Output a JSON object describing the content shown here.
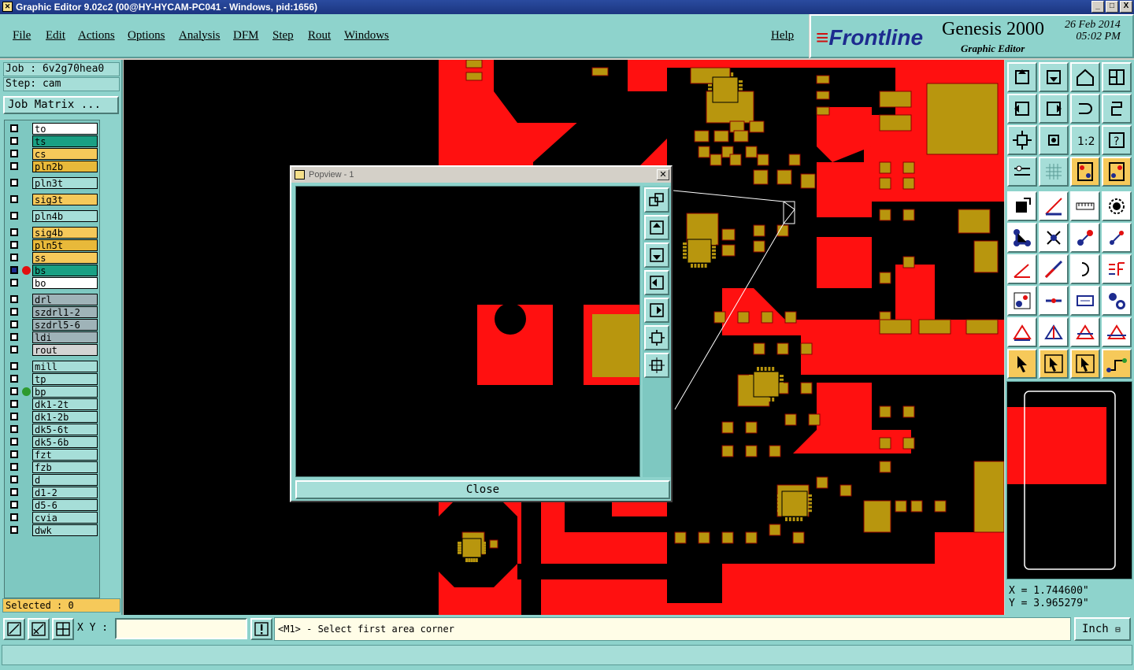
{
  "window": {
    "title": "Graphic Editor 9.02c2 (00@HY-HYCAM-PC041 - Windows, pid:1656)",
    "buttons": [
      "_",
      "□",
      "X"
    ]
  },
  "menu": [
    "File",
    "Edit",
    "Actions",
    "Options",
    "Analysis",
    "DFM",
    "Step",
    "Rout",
    "Windows",
    "Help"
  ],
  "logo": {
    "brand": "Frontline",
    "product": "Genesis 2000",
    "subtitle": "Graphic Editor",
    "date": "26 Feb 2014",
    "time": "05:02 PM"
  },
  "job": {
    "job_label": "Job : 6v2g70hea0",
    "step_label": "Step: cam",
    "matrix_button": "Job Matrix ..."
  },
  "layers": [
    {
      "name": "to",
      "color": "#ffffff",
      "group": 0
    },
    {
      "name": "ts",
      "color": "#1aa084",
      "group": 0
    },
    {
      "name": "cs",
      "color": "#f6c95a",
      "group": 0
    },
    {
      "name": "pln2b",
      "color": "#e8b93a",
      "group": 0
    },
    {
      "name": "pln3t",
      "color": "#a6ded8",
      "group": 1
    },
    {
      "name": "sig3t",
      "color": "#f6c95a",
      "group": 2
    },
    {
      "name": "pln4b",
      "color": "#a6ded8",
      "group": 3
    },
    {
      "name": "sig4b",
      "color": "#f6c95a",
      "group": 4
    },
    {
      "name": "pln5t",
      "color": "#e8b93a",
      "group": 4
    },
    {
      "name": "ss",
      "color": "#f6c95a",
      "group": 4
    },
    {
      "name": "bs",
      "color": "#1aa084",
      "group": 4,
      "dot": "#e21010",
      "active": true
    },
    {
      "name": "bo",
      "color": "#ffffff",
      "group": 4
    },
    {
      "name": "drl",
      "color": "#9fb3b8",
      "group": 5
    },
    {
      "name": "szdrl1-2",
      "color": "#9fb3b8",
      "group": 5
    },
    {
      "name": "szdrl5-6",
      "color": "#9fb3b8",
      "group": 5
    },
    {
      "name": "ldi",
      "color": "#9fb3b8",
      "group": 5
    },
    {
      "name": "rout",
      "color": "#d4d4d4",
      "group": 5
    },
    {
      "name": "mill",
      "color": "#a6ded8",
      "group": 6
    },
    {
      "name": "tp",
      "color": "#a6ded8",
      "group": 6
    },
    {
      "name": "bp",
      "color": "#a6ded8",
      "group": 6,
      "dot": "#2e9a2e"
    },
    {
      "name": "dk1-2t",
      "color": "#a6ded8",
      "group": 6
    },
    {
      "name": "dk1-2b",
      "color": "#a6ded8",
      "group": 6
    },
    {
      "name": "dk5-6t",
      "color": "#a6ded8",
      "group": 6
    },
    {
      "name": "dk5-6b",
      "color": "#a6ded8",
      "group": 6
    },
    {
      "name": "fzt",
      "color": "#a6ded8",
      "group": 6
    },
    {
      "name": "fzb",
      "color": "#a6ded8",
      "group": 6
    },
    {
      "name": "d",
      "color": "#a6ded8",
      "group": 6
    },
    {
      "name": "d1-2",
      "color": "#a6ded8",
      "group": 6
    },
    {
      "name": "d5-6",
      "color": "#a6ded8",
      "group": 6
    },
    {
      "name": "cvia",
      "color": "#a6ded8",
      "group": 6
    },
    {
      "name": "dwk",
      "color": "#a6ded8",
      "group": 6
    }
  ],
  "selected": "Selected : 0",
  "popview": {
    "title": "Popview - 1",
    "close_label": "Close"
  },
  "coords": {
    "x": "X = 1.744600\"",
    "y": "Y = 3.965279\""
  },
  "bottom": {
    "xy_label": "X Y :",
    "xy_value": "",
    "prompt": "<M1> - Select first area corner",
    "units": "Inch"
  },
  "colors": {
    "copper": "#ff1010",
    "pad": "#b8960e",
    "background": "#000000",
    "panel": "#8ed3cc"
  },
  "toolbar_icons": [
    "zoom-home-icon",
    "zoom-out-icon",
    "home-icon",
    "window-icon",
    "pan-left-icon",
    "pan-right-icon",
    "rotate-icon",
    "mirror-icon",
    "fit-icon",
    "center-icon",
    "one-to-one-icon",
    "help-icon",
    "measure-icon",
    "grid-icon",
    "snap-icon",
    "snap-alt-icon",
    "select-pad-icon",
    "edit-line-icon",
    "ruler-icon",
    "circle-select-icon",
    "connect-icon",
    "cross-icon",
    "add-line-icon",
    "move-line-icon",
    "slope-icon",
    "diagonal-icon",
    "arc-icon",
    "layer-merge-icon",
    "pad-move-icon",
    "minus-icon",
    "measure-box-icon",
    "clusters-icon",
    "triangle-icon",
    "triangle-up-icon",
    "triangle-cross-icon",
    "triangle-fill-icon",
    "pointer-icon",
    "pointer-box-icon",
    "pointer-select-icon",
    "route-icon"
  ]
}
